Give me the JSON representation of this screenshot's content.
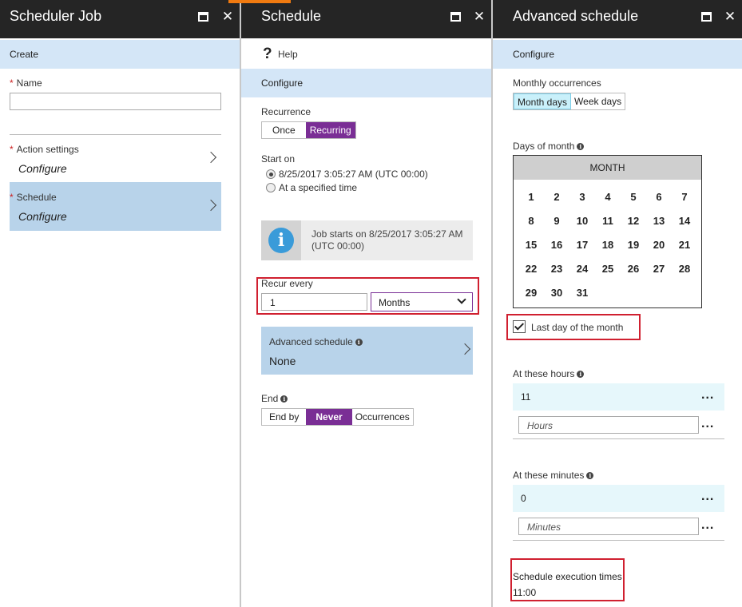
{
  "panel1": {
    "title": "Scheduler Job",
    "create": "Create",
    "name_label": "Name",
    "required_mark": "*",
    "action_label": "Action settings",
    "action_value": "Configure",
    "schedule_label": "Schedule",
    "schedule_value": "Configure"
  },
  "panel2": {
    "title": "Schedule",
    "help": "Help",
    "configure": "Configure",
    "recurrence_label": "Recurrence",
    "recurrence_options": [
      "Once",
      "Recurring"
    ],
    "start_label": "Start on",
    "start_option_now": "8/25/2017 3:05:27 AM (UTC 00:00)",
    "start_option_specified": "At a specified time",
    "info_text": "Job starts on 8/25/2017 3:05:27 AM (UTC 00:00)",
    "recur_label": "Recur every",
    "recur_value": "1",
    "recur_unit": "Months",
    "advanced_label": "Advanced schedule",
    "advanced_value": "None",
    "end_label": "End",
    "end_options": [
      "End by",
      "Never",
      "Occurrences"
    ]
  },
  "panel3": {
    "title": "Advanced schedule",
    "configure": "Configure",
    "monthly_label": "Monthly occurrences",
    "monthly_options": [
      "Month days",
      "Week days"
    ],
    "days_label": "Days of month",
    "calendar_header": "MONTH",
    "days": [
      [
        "1",
        "2",
        "3",
        "4",
        "5",
        "6",
        "7"
      ],
      [
        "8",
        "9",
        "10",
        "11",
        "12",
        "13",
        "14"
      ],
      [
        "15",
        "16",
        "17",
        "18",
        "19",
        "20",
        "21"
      ],
      [
        "22",
        "23",
        "24",
        "25",
        "26",
        "27",
        "28"
      ],
      [
        "29",
        "30",
        "31"
      ]
    ],
    "last_day_label": "Last day of the month",
    "hours_label": "At these hours",
    "hours_value": "11",
    "hours_placeholder": "Hours",
    "minutes_label": "At these minutes",
    "minutes_value": "0",
    "minutes_placeholder": "Minutes",
    "exec_label": "Schedule execution times",
    "exec_value": "11:00",
    "more": "..."
  },
  "colors": {
    "accent_purple": "#7a2e95",
    "band_blue": "#d4e6f7",
    "select_blue": "#b8d3ea",
    "highlight_red": "#d02030",
    "top_orange": "#f07a10"
  }
}
